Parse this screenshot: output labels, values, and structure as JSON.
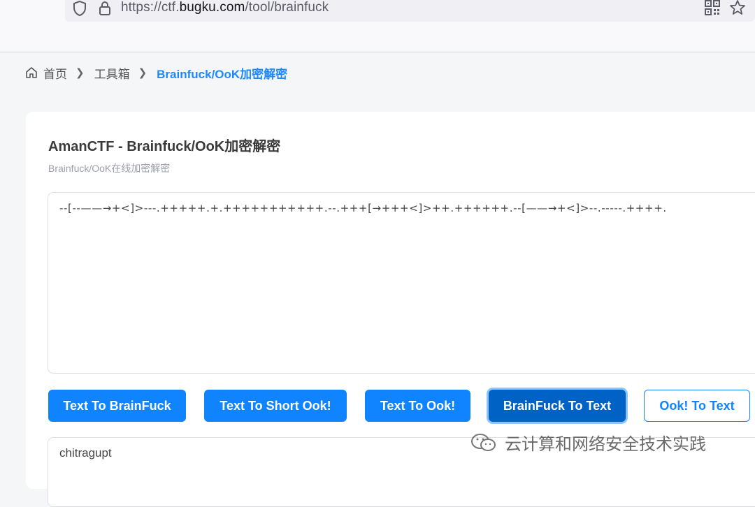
{
  "browser": {
    "url_prefix": "https://ctf.",
    "url_domain": "bugku.com",
    "url_path": "/tool/brainfuck"
  },
  "breadcrumb": {
    "home": "首页",
    "toolbox": "工具箱",
    "current": "Brainfuck/OoK加密解密"
  },
  "card": {
    "title": "AmanCTF - Brainfuck/OoK加密解密",
    "subtitle": "Brainfuck/OoK在线加密解密",
    "input_value": "--[--——→+<]>---.+++++.+.+++++++++++.--.+++[→+++<]>++.++++++.--[——→+<]>--.-----.++++.",
    "output_value": "chitragupt"
  },
  "buttons": {
    "text_to_brainfuck": "Text To BrainFuck",
    "text_to_short_ook": "Text To Short Ook!",
    "text_to_ook": "Text To Ook!",
    "brainfuck_to_text": "BrainFuck To Text",
    "ook_to_text": "Ook! To Text"
  },
  "watermark": {
    "text": "云计算和网络安全技术实践"
  },
  "colors": {
    "accent": "#1084ff",
    "active_button": "#0062c4",
    "breadcrumb_current": "#1e88ff"
  }
}
